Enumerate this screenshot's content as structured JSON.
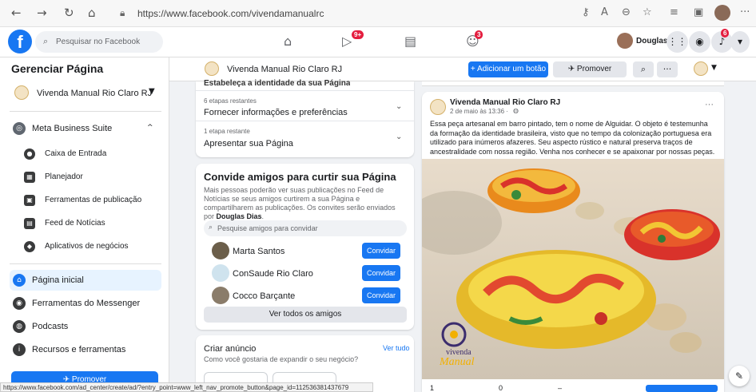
{
  "browser": {
    "url": "https://www.facebook.com/vivendamanualrc",
    "status_url": "https://www.facebook.com/ad_center/create/ad/?entry_point=www_left_nav_promote_button&page_id=112536381437679"
  },
  "header": {
    "search_placeholder": "Pesquisar no Facebook",
    "notif_badge_watch": "9+",
    "notif_badge_groups": "3",
    "notif_badge_bell": "6",
    "user_name": "Douglas"
  },
  "sidebar": {
    "title": "Gerenciar Página",
    "page_name": "Vivenda Manual Rio Claro RJ",
    "business_suite": "Meta Business Suite",
    "sub_items": [
      {
        "label": "Caixa de Entrada",
        "icon": "inbox-icon"
      },
      {
        "label": "Planejador",
        "icon": "calendar-icon"
      },
      {
        "label": "Ferramentas de publicação",
        "icon": "publishing-tools-icon"
      },
      {
        "label": "Feed de Notícias",
        "icon": "news-feed-icon"
      },
      {
        "label": "Aplicativos de negócios",
        "icon": "business-apps-icon"
      }
    ],
    "items": [
      {
        "label": "Página inicial",
        "icon": "home-icon"
      },
      {
        "label": "Ferramentas do Messenger",
        "icon": "messenger-icon"
      },
      {
        "label": "Podcasts",
        "icon": "podcast-icon"
      },
      {
        "label": "Recursos e ferramentas",
        "icon": "info-icon"
      }
    ],
    "promote_label": "Promover"
  },
  "page_strip": {
    "page_name": "Vivenda Manual Rio Claro RJ",
    "add_button": "+ Adicionar um botão",
    "promote": "Promover",
    "more": "···"
  },
  "setup": {
    "cut_text": "Estabeleça a identidade da sua Página",
    "step1_meta": "6 etapas restantes",
    "step1_title": "Fornecer informações e preferências",
    "step2_meta": "1 etapa restante",
    "step2_title": "Apresentar sua Página"
  },
  "invite": {
    "title": "Convide amigos para curtir sua Página",
    "desc_prefix": "Mais pessoas poderão ver suas publicações no Feed de Notícias se seus amigos curtirem a sua Página e compartilharem as publicações. Os convites serão enviados por ",
    "desc_name": "Douglas Dias",
    "desc_suffix": ".",
    "search_placeholder": "Pesquise amigos para convidar",
    "invite_label": "Convidar",
    "friends": [
      {
        "name": "Marta Santos"
      },
      {
        "name": "ConSaude Rio Claro"
      },
      {
        "name": "Cocco Barçante"
      }
    ],
    "see_all": "Ver todos os amigos"
  },
  "ad": {
    "title": "Criar anúncio",
    "see_all": "Ver tudo",
    "subtitle": "Como você gostaria de expandir o seu negócio?"
  },
  "post": {
    "author": "Vivenda Manual Rio Claro RJ",
    "time": "2 de maio às 13:36 · ",
    "more": "···",
    "text": "Essa peça artesanal em barro pintado, tem o nome de Alguidar. O objeto é testemunha da formação da identidade brasileira, visto que no tempo da colonização portuguesa era utilizado para inúmeros afazeres. Seu aspecto rústico e natural preserva traços de ancestralidade com nossa região. Venha nos conhecer e se apaixonar por nossas peças.",
    "watermark_line1": "vivenda",
    "watermark_line2": "Manual",
    "footer_left": "1",
    "footer_mid": "0",
    "footer_dash": "–"
  },
  "colors": {
    "accent": "#1877f2",
    "badge": "#e41e3f",
    "bg": "#f0f2f5"
  }
}
